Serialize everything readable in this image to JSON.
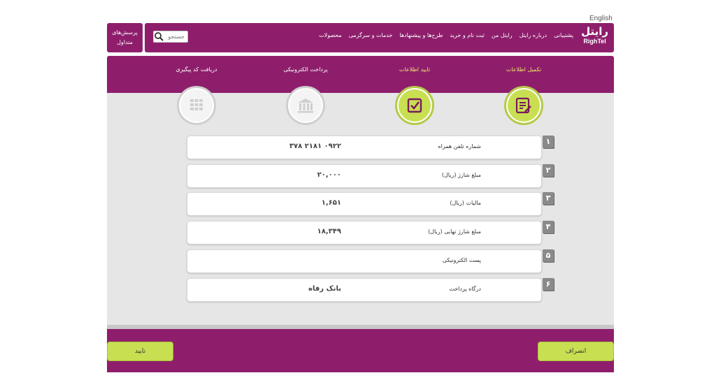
{
  "header": {
    "language_link": "English",
    "faq_label_line1": "پرسش‌های",
    "faq_label_line2": "متداول",
    "search_placeholder": "جستجو",
    "nav_items": [
      "محصولات",
      "خدمات و سرگرمی",
      "طرح‌ها و پیشنهادها",
      "ثبت نام و خرید",
      "رایتل من",
      "درباره رایتل",
      "پشتیبانی"
    ],
    "logo_fa": "رایتل",
    "logo_en": "RighTel"
  },
  "steps": [
    {
      "label": "تکمیل اطلاعات",
      "icon": "edit-form-icon",
      "active": true
    },
    {
      "label": "تایید اطلاعات",
      "icon": "checkbox-icon",
      "active": true
    },
    {
      "label": "پرداخت الکترونیکی",
      "icon": "bank-icon",
      "active": false
    },
    {
      "label": "دریافت کد پیگیری",
      "icon": "keypad-icon",
      "active": false
    }
  ],
  "rows": [
    {
      "num": "۱",
      "label": "شماره تلفن همراه",
      "value": "۰۹۲۲ ۲۱۸۱ ۳۷۸"
    },
    {
      "num": "۲",
      "label": "مبلغ شارژ (ریال)",
      "value": "۲۰,۰۰۰"
    },
    {
      "num": "۳",
      "label": "مالیات (ریال)",
      "value": "۱,۶۵۱"
    },
    {
      "num": "۴",
      "label": "مبلغ شارژ نهایی (ریال)",
      "value": "۱۸,۳۴۹"
    },
    {
      "num": "۵",
      "label": "پست الکترونیکی",
      "value": ""
    },
    {
      "num": "۶",
      "label": "درگاه پرداخت",
      "value": "بانک رفاه"
    }
  ],
  "buttons": {
    "confirm": "تایید",
    "cancel": "انصراف"
  },
  "colors": {
    "brand": "#8e1e6c",
    "accent": "#c8df52",
    "step_active_text": "#f2e86b"
  }
}
